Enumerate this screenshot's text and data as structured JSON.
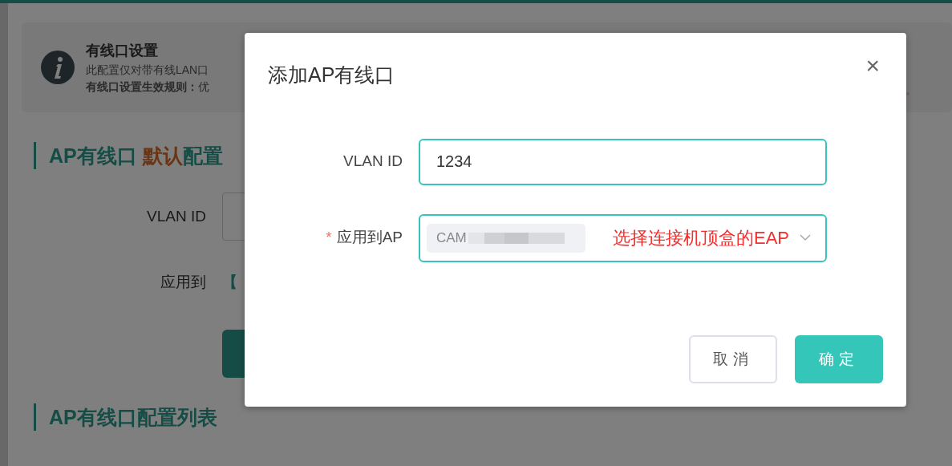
{
  "page": {
    "notice": {
      "title": "有线口设置",
      "line_1": "此配置仅对带有线LAN口",
      "line_2_bold": "有线口设置生效规则：",
      "line_2_rest": "优",
      "line_end_fragment": "。"
    },
    "default_section": {
      "title_start": "AP有线口 ",
      "title_highlight": "默认",
      "title_end": "配置",
      "vlan_label": "VLAN ID",
      "apply_label": "应用到",
      "apply_value_fragment": "【"
    },
    "list_section": {
      "title": "AP有线口配置列表"
    }
  },
  "modal": {
    "title": "添加AP有线口",
    "close": "×",
    "fields": [
      {
        "kind": "input",
        "label": "VLAN ID",
        "value": "1234"
      },
      {
        "kind": "select",
        "label": "应用到AP",
        "required_mark": "*",
        "tags": [
          "CAM"
        ],
        "annotation": "选择连接机顶盒的EAP"
      }
    ],
    "buttons": [
      {
        "label": "取消",
        "primary": false
      },
      {
        "label": "确定",
        "primary": true
      }
    ]
  }
}
